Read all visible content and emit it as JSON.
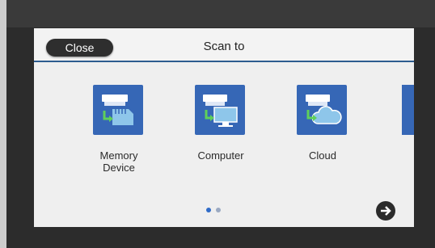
{
  "header": {
    "close_label": "Close",
    "title": "Scan to"
  },
  "tiles": [
    {
      "label": "Memory\nDevice",
      "icon": "memory-device-icon"
    },
    {
      "label": "Computer",
      "icon": "computer-icon"
    },
    {
      "label": "Cloud",
      "icon": "cloud-icon"
    }
  ],
  "pagination": {
    "pages": 2,
    "current": 1
  },
  "colors": {
    "accent": "#3667b6",
    "header_rule": "#2d5c8f",
    "active_dot": "#2f6bc8",
    "inactive_dot": "#9aa9c2"
  }
}
